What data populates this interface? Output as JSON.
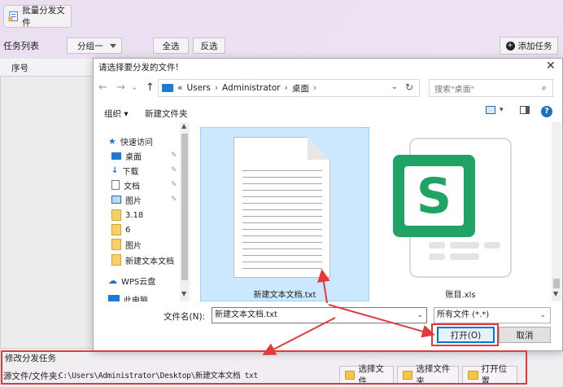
{
  "app": {
    "batch_button": "批量分发文件",
    "task_list_label": "任务列表",
    "group_select": "分组一",
    "select_all": "全选",
    "invert_select": "反选",
    "add_task": "添加任务",
    "column_index": "序号"
  },
  "bottom": {
    "section_title": "修改分发任务",
    "source_label": "源文件/文件夹:",
    "source_value": "C:\\Users\\Administrator\\Desktop\\新建文本文档 txt",
    "select_file": "选择文件",
    "select_folder": "选择文件夹",
    "open_location": "打开位置"
  },
  "dialog": {
    "title": "请选择要分发的文件!",
    "close": "✕",
    "address": {
      "prefix": "«",
      "crumbs": [
        "Users",
        "Administrator",
        "桌面"
      ]
    },
    "search_placeholder": "搜索\"桌面\"",
    "organize": "组织 ▾",
    "new_folder": "新建文件夹",
    "help": "?",
    "nav_items": [
      {
        "label": "快速访问",
        "icon": "star-icon"
      },
      {
        "label": "桌面",
        "icon": "desktop-icon"
      },
      {
        "label": "下载",
        "icon": "download-icon"
      },
      {
        "label": "文档",
        "icon": "document-icon"
      },
      {
        "label": "图片",
        "icon": "picture-icon"
      },
      {
        "label": "3.18",
        "icon": "folder-icon"
      },
      {
        "label": "6",
        "icon": "folder-icon"
      },
      {
        "label": "图片",
        "icon": "folder-icon"
      },
      {
        "label": "新建文本文档",
        "icon": "folder-icon"
      },
      {
        "label": "WPS云盘",
        "icon": "cloud-icon"
      },
      {
        "label": "此电脑",
        "icon": "computer-icon"
      }
    ],
    "files": [
      {
        "name": "新建文本文档.txt",
        "type": "txt",
        "selected": true
      },
      {
        "name": "账目.xls",
        "type": "xls",
        "selected": false
      }
    ],
    "filename_label": "文件名(N):",
    "filename_value": "新建文本文档.txt",
    "filetype": "所有文件 (*.*)",
    "open_button": "打开(O)",
    "cancel_button": "取消"
  },
  "colors": {
    "accent": "#0078d7",
    "annotation_red": "#e23a3a",
    "selection": "#cce8ff",
    "xls_green": "#21a366"
  }
}
